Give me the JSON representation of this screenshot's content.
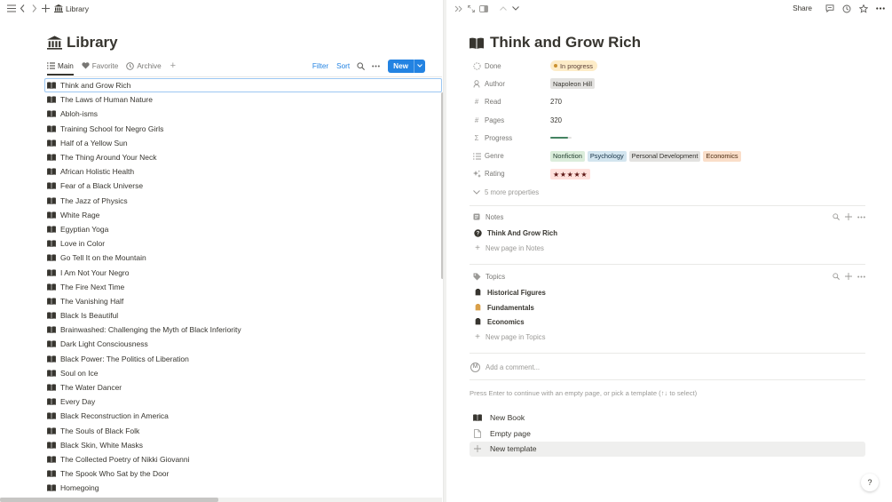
{
  "topbar": {
    "breadcrumb": "Library"
  },
  "library": {
    "title": "Library",
    "views": [
      {
        "label": "Main",
        "icon": "list-icon",
        "active": true
      },
      {
        "label": "Favorite",
        "icon": "heart-icon",
        "active": false
      },
      {
        "label": "Archive",
        "icon": "clock-icon",
        "active": false
      }
    ],
    "toolbar": {
      "filter_label": "Filter",
      "sort_label": "Sort",
      "new_label": "New"
    },
    "books": [
      "Think and Grow Rich",
      "The Laws of Human Nature",
      "Abloh-isms",
      "Training School for Negro Girls",
      "Half of a Yellow Sun",
      "The Thing Around Your Neck",
      "African Holistic Health",
      "Fear of a Black Universe",
      "The Jazz of Physics",
      "White Rage",
      "Egyptian Yoga",
      "Love in Color",
      "Go Tell It on the Mountain",
      "I Am Not Your Negro",
      "The Fire Next Time",
      "The Vanishing Half",
      "Black Is Beautiful",
      "Brainwashed: Challenging the Myth of Black Inferiority",
      "Dark Light Consciousness",
      "Black Power: The Politics of Liberation",
      "Soul on Ice",
      "The Water Dancer",
      "Every Day",
      "Black Reconstruction in America",
      "The Souls of Black Folk",
      "Black Skin, White Masks",
      "The Collected Poetry of Nikki Giovanni",
      "The Spook Who Sat by the Door",
      "Homegoing"
    ]
  },
  "page": {
    "share_label": "Share",
    "title": "Think and Grow Rich",
    "properties": {
      "done": {
        "label": "Done",
        "value": "In progress"
      },
      "author": {
        "label": "Author",
        "value": "Napoleon Hill"
      },
      "read": {
        "label": "Read",
        "value": "270"
      },
      "pages": {
        "label": "Pages",
        "value": "320"
      },
      "progress": {
        "label": "Progress",
        "fraction": 0.84
      },
      "genre": {
        "label": "Genre",
        "tags": [
          {
            "label": "Nonfiction",
            "bg": "#dbeddb",
            "fg": "#1c3829"
          },
          {
            "label": "Psychology",
            "bg": "#d3e5ef",
            "fg": "#183347"
          },
          {
            "label": "Personal Development",
            "bg": "#e3e2e0",
            "fg": "#32302c"
          },
          {
            "label": "Economics",
            "bg": "#fadec9",
            "fg": "#49290e"
          }
        ]
      },
      "rating": {
        "label": "Rating",
        "value": "★★★★★"
      },
      "more": "5 more properties"
    },
    "notes": {
      "label": "Notes",
      "items": [
        "Think And Grow Rich"
      ],
      "new_label": "New page in Notes"
    },
    "topics": {
      "label": "Topics",
      "items": [
        "Historical Figures",
        "Fundamentals",
        "Economics"
      ],
      "new_label": "New page in Topics"
    },
    "comment_placeholder": "Add a comment...",
    "avatar_letter": "M",
    "hint": "Press Enter to continue with an empty page, or pick a template (↑↓ to select)",
    "templates": [
      "New Book",
      "Empty page",
      "New template"
    ]
  },
  "help_label": "?",
  "colors": {
    "accent": "#2383e2",
    "status_bg": "#fdecc8",
    "progress_green": "#448361",
    "rating_bg": "#ffe2dd"
  }
}
